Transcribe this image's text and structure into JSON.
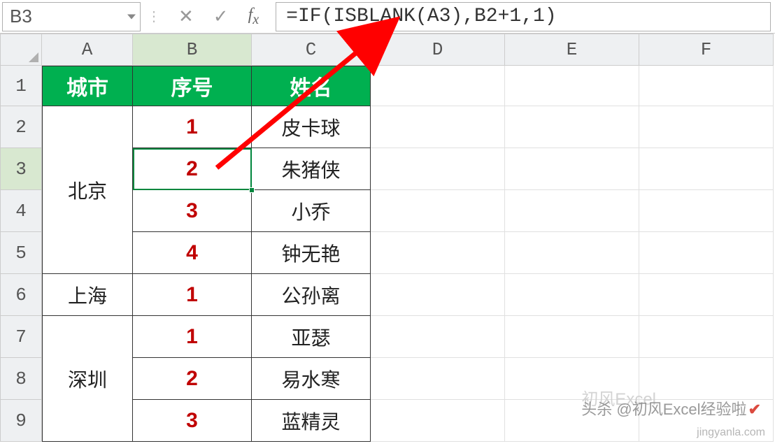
{
  "namebox": {
    "value": "B3"
  },
  "formula": {
    "value": "=IF(ISBLANK(A3),B2+1,1)"
  },
  "columns": [
    "A",
    "B",
    "C",
    "D",
    "E",
    "F"
  ],
  "rows": [
    "1",
    "2",
    "3",
    "4",
    "5",
    "6",
    "7",
    "8",
    "9"
  ],
  "header": {
    "A": "城市",
    "B": "序号",
    "C": "姓名"
  },
  "groups": [
    {
      "city": "北京",
      "rows": [
        {
          "seq": "1",
          "name": "皮卡球"
        },
        {
          "seq": "2",
          "name": "朱猪侠"
        },
        {
          "seq": "3",
          "name": "小乔"
        },
        {
          "seq": "4",
          "name": "钟无艳"
        }
      ]
    },
    {
      "city": "上海",
      "rows": [
        {
          "seq": "1",
          "name": "公孙离"
        }
      ]
    },
    {
      "city": "深圳",
      "rows": [
        {
          "seq": "1",
          "name": "亚瑟"
        },
        {
          "seq": "2",
          "name": "易水寒"
        },
        {
          "seq": "3",
          "name": "蓝精灵"
        }
      ]
    }
  ],
  "watermarks": {
    "line1a": "头杀 @初风Excel",
    "line1b": "经验啦",
    "line2": "jingyanla.com",
    "faded": "初风Excel"
  },
  "chart_data": {
    "type": "table",
    "title": "",
    "columns": [
      "城市",
      "序号",
      "姓名"
    ],
    "rows": [
      [
        "北京",
        "1",
        "皮卡球"
      ],
      [
        "北京",
        "2",
        "朱猪侠"
      ],
      [
        "北京",
        "3",
        "小乔"
      ],
      [
        "北京",
        "4",
        "钟无艳"
      ],
      [
        "上海",
        "1",
        "公孙离"
      ],
      [
        "深圳",
        "1",
        "亚瑟"
      ],
      [
        "深圳",
        "2",
        "易水寒"
      ],
      [
        "深圳",
        "3",
        "蓝精灵"
      ]
    ]
  }
}
